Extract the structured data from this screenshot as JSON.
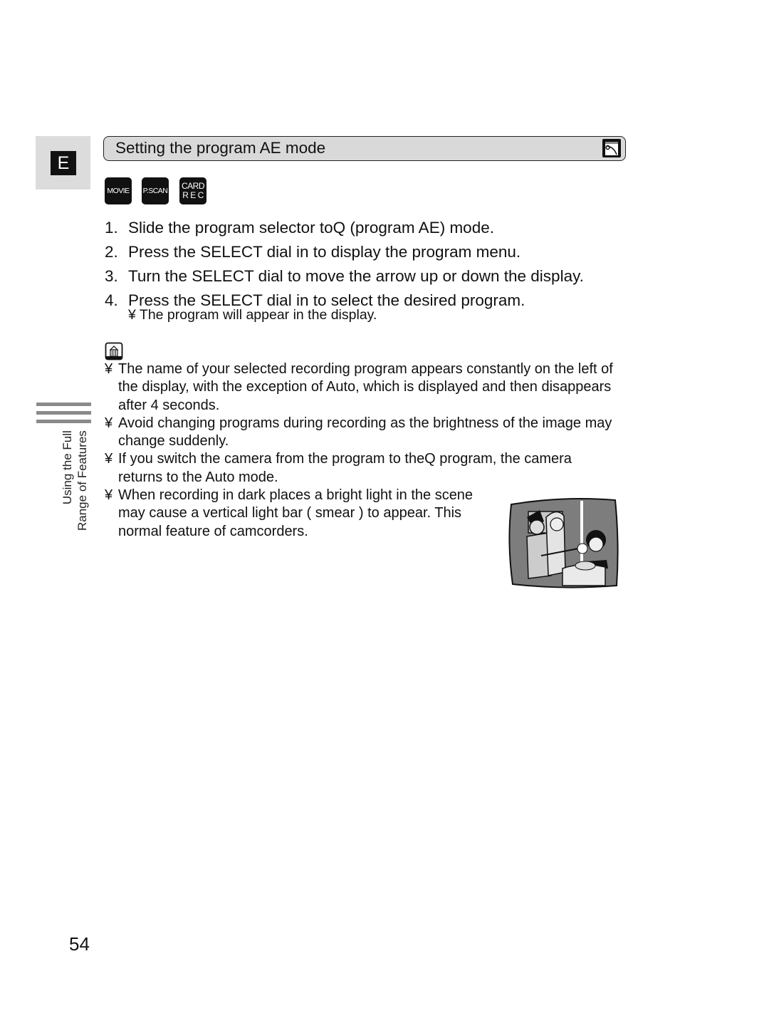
{
  "language_tab": {
    "letter": "E"
  },
  "section": {
    "title": "Setting the program AE mode",
    "icon": "program-ae-icon"
  },
  "modes": [
    {
      "label": "MOVIE"
    },
    {
      "label": "P.SCAN"
    },
    {
      "label_line1": "CARD",
      "label_line2": "R E C"
    }
  ],
  "steps": [
    {
      "num": "1.",
      "text": "Slide the program selector toQ (program AE) mode."
    },
    {
      "num": "2.",
      "text": "Press the SELECT dial in to display the program menu."
    },
    {
      "num": "3.",
      "text": "Turn the SELECT dial to move the arrow up or down the display."
    },
    {
      "num": "4.",
      "text": "Press the SELECT dial in to select the desired program."
    }
  ],
  "step4_note": "¥  The program will appear in the display.",
  "notes_icon": "notes-trash-icon",
  "notes": [
    {
      "bullet": "¥",
      "text": "The name of your selected recording program appears constantly on the left of\nthe display, with the exception of Auto, which is displayed and then disappears\nafter 4 seconds."
    },
    {
      "bullet": "¥",
      "text": "Avoid changing programs during recording as the brightness of the image may\nchange suddenly."
    },
    {
      "bullet": "¥",
      "text": "If you switch the camera from the program to theQ program, the camera\nreturns to the Auto mode."
    },
    {
      "bullet": "¥",
      "text": "When recording in dark places a bright light in the scene\nmay cause a vertical light bar ( smear ) to appear. This\nnormal feature of camcorders."
    }
  ],
  "side_label": {
    "line1": "Using the Full",
    "line2": "Range of Features"
  },
  "illustration": {
    "subject": "tv-screen-smear-illustration"
  },
  "page_number": "54"
}
